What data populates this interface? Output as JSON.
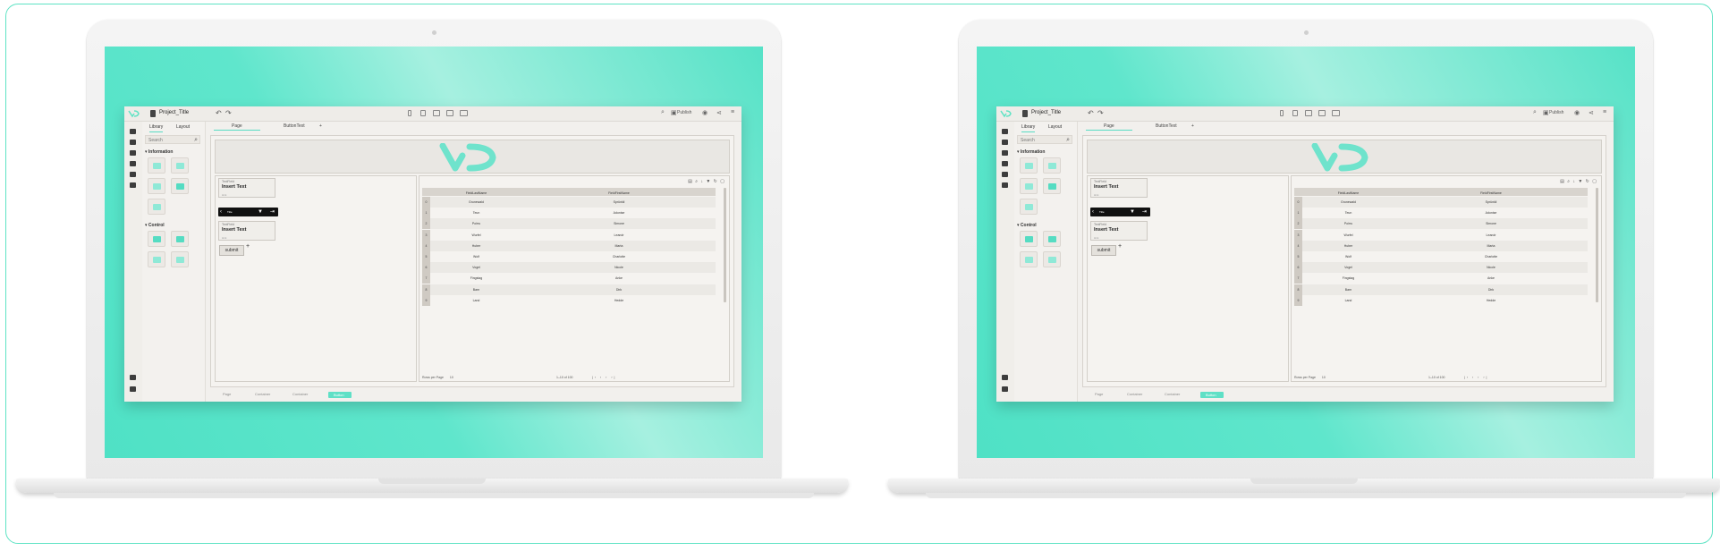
{
  "app": {
    "project_title": "Project_Title",
    "publish_label": "Publish",
    "library_tabs": [
      "Library",
      "Layout"
    ],
    "search_placeholder": "Search",
    "sections": {
      "information": "Information",
      "control": "Control"
    },
    "page_tabs": [
      "Page",
      "ButtonText",
      "+"
    ],
    "form": {
      "field1_caption": "TextField",
      "field1_value": "Insert Text",
      "field1_help": "Hint",
      "field2_caption": "TextField",
      "field2_value": "Insert Text",
      "field2_help": "Hint",
      "toolbar_label": "Title",
      "submit_label": "submit",
      "add_label": "+"
    },
    "table": {
      "headers": [
        "FieldLastName",
        "FieldFirstName"
      ],
      "rows": [
        {
          "idx": "0",
          "last": "Grunewald",
          "first": "Sprünkli"
        },
        {
          "idx": "1",
          "last": "Teun",
          "first": "Adonise"
        },
        {
          "idx": "2",
          "last": "Poirru",
          "first": "Simone"
        },
        {
          "idx": "3",
          "last": "Wurfel",
          "first": "Leandr"
        },
        {
          "idx": "4",
          "last": "Huber",
          "first": "Marta"
        },
        {
          "idx": "5",
          "last": "Wolf",
          "first": "Charlotte"
        },
        {
          "idx": "6",
          "last": "Vogel",
          "first": "Nicole"
        },
        {
          "idx": "7",
          "last": "Fingstag",
          "first": "Anke"
        },
        {
          "idx": "8",
          "last": "Barn",
          "first": "Dirk"
        },
        {
          "idx": "9",
          "last": "Land",
          "first": "Hedde"
        }
      ],
      "footer_left": "Rows per Page",
      "footer_page": "10",
      "footer_right": "1–10 of 100"
    },
    "breadcrumbs": [
      "Page",
      "Container",
      "Container",
      "Button"
    ]
  },
  "colors": {
    "accent": "#58dcc3",
    "screen": "#56e2c7",
    "frame_border": "#5ee3c4"
  }
}
